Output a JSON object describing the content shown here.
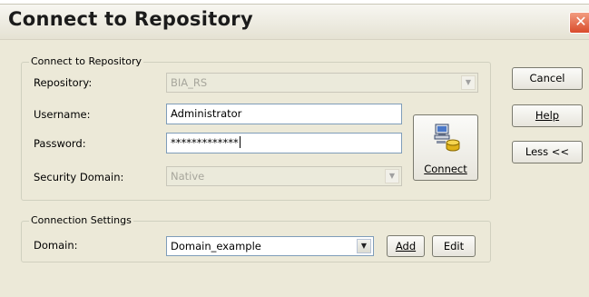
{
  "window": {
    "title": "Connect to Repository",
    "close_label": "✕"
  },
  "repo_group": {
    "legend": "Connect to Repository",
    "repository": {
      "label": "Repository:",
      "value": "BIA_RS"
    },
    "username": {
      "label": "Username:",
      "value": "Administrator"
    },
    "password": {
      "label": "Password:",
      "value": "*************"
    },
    "security_domain": {
      "label": "Security Domain:",
      "value": "Native"
    },
    "connect_label": "Connect"
  },
  "settings_group": {
    "legend": "Connection Settings",
    "domain": {
      "label": "Domain:",
      "value": "Domain_example"
    },
    "add_label": "Add",
    "edit_label": "Edit"
  },
  "side_buttons": {
    "cancel": "Cancel",
    "help": "Help",
    "less": "Less <<"
  },
  "icons": {
    "connect": "computer-database-icon",
    "dropdown": "chevron-down-icon",
    "close": "close-icon"
  },
  "colors": {
    "dialog_bg": "#ece9d8",
    "close_button": "#d94b2b",
    "field_border": "#7f9db9"
  }
}
